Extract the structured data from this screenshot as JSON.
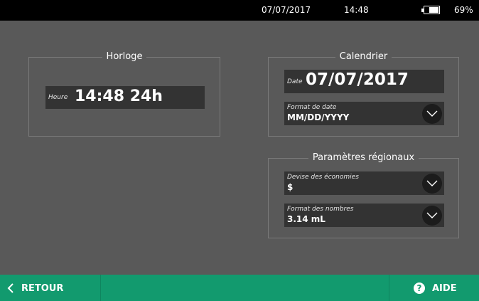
{
  "status_bar": {
    "date": "07/07/2017",
    "time": "14:48",
    "battery_percent": "69%",
    "battery_level": 0.69
  },
  "clock": {
    "title": "Horloge",
    "time_label": "Heure",
    "time_value": "14:48 24h"
  },
  "calendar": {
    "title": "Calendrier",
    "date_label": "Date",
    "date_value": "07/07/2017",
    "format_label": "Format de date",
    "format_value": "MM/DD/YYYY"
  },
  "regional": {
    "title": "Paramètres régionaux",
    "currency_label": "Devise des économies",
    "currency_value": "$",
    "number_format_label": "Format des nombres",
    "number_format_value": "3.14 mL"
  },
  "footer": {
    "back_label": "RETOUR",
    "help_label": "AIDE",
    "help_glyph": "?"
  },
  "colors": {
    "background": "#595959",
    "footer": "#129a6e",
    "field": "#333333"
  }
}
